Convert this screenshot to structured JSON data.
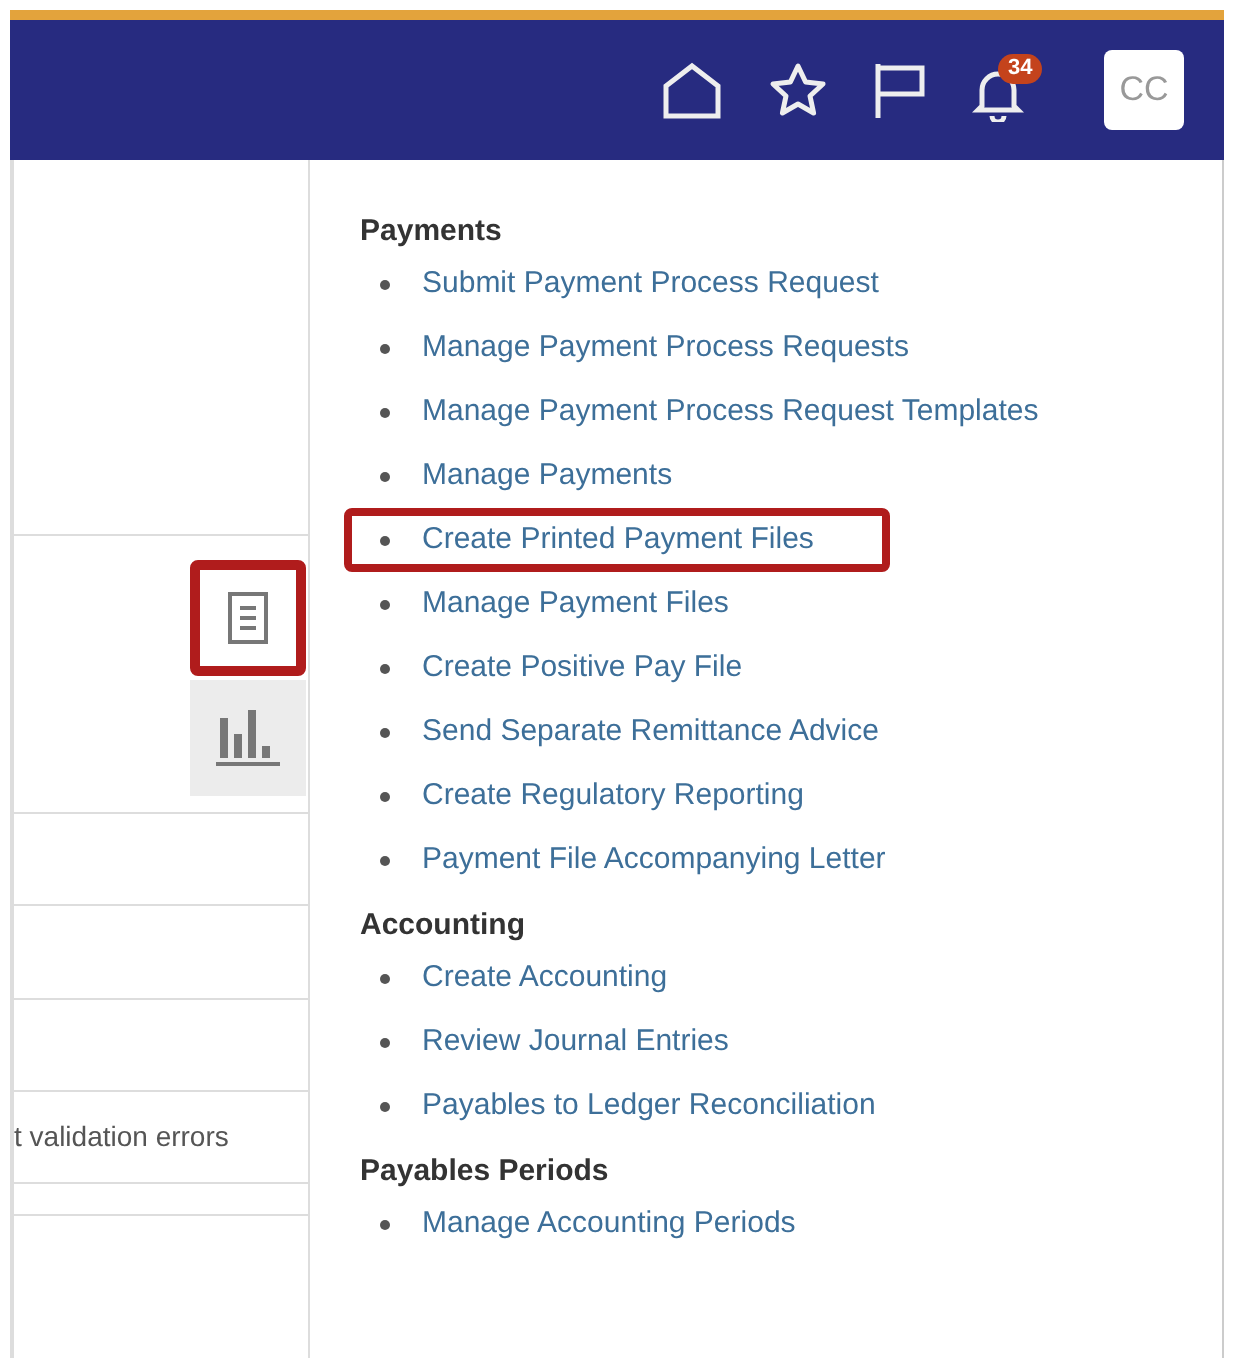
{
  "header": {
    "notification_count": "34",
    "user_initials": "CC"
  },
  "left_panel": {
    "tools": [
      {
        "kind": "document",
        "selected": false,
        "highlighted": true
      },
      {
        "kind": "chart",
        "selected": true,
        "highlighted": false
      }
    ],
    "rows": [
      "t validation errors"
    ]
  },
  "menu": {
    "sections": [
      {
        "title": "Payments",
        "items": [
          {
            "label": "Submit Payment Process Request",
            "highlighted": false
          },
          {
            "label": "Manage Payment Process Requests",
            "highlighted": false
          },
          {
            "label": "Manage Payment Process Request Templates",
            "highlighted": false
          },
          {
            "label": "Manage Payments",
            "highlighted": false
          },
          {
            "label": "Create Printed Payment Files",
            "highlighted": true
          },
          {
            "label": "Manage Payment Files",
            "highlighted": false
          },
          {
            "label": "Create Positive Pay File",
            "highlighted": false
          },
          {
            "label": "Send Separate Remittance Advice",
            "highlighted": false
          },
          {
            "label": "Create Regulatory Reporting",
            "highlighted": false
          },
          {
            "label": "Payment File Accompanying Letter",
            "highlighted": false
          }
        ]
      },
      {
        "title": "Accounting",
        "items": [
          {
            "label": "Create Accounting",
            "highlighted": false
          },
          {
            "label": "Review Journal Entries",
            "highlighted": false
          },
          {
            "label": "Payables to Ledger Reconciliation",
            "highlighted": false
          }
        ]
      },
      {
        "title": "Payables Periods",
        "items": [
          {
            "label": "Manage Accounting Periods",
            "highlighted": false
          }
        ]
      }
    ]
  }
}
